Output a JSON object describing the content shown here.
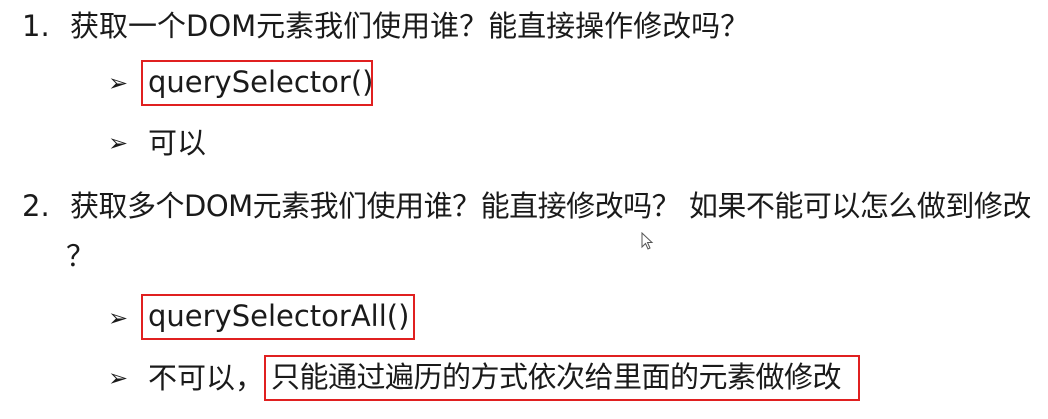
{
  "q1": {
    "number": "1.",
    "text": "获取一个DOM元素我们使用谁？能直接操作修改吗？",
    "answers": [
      {
        "bullet": "➢",
        "text": "querySelector()"
      },
      {
        "bullet": "➢",
        "text": "可以"
      }
    ]
  },
  "q2": {
    "number": "2.",
    "text_line1": "获取多个DOM元素我们使用谁？能直接修改吗？ 如果不能可以怎么做到修改",
    "text_line2": "？",
    "answers": [
      {
        "bullet": "➢",
        "text": "querySelectorAll()"
      },
      {
        "bullet": "➢",
        "prefix": "不可以，",
        "highlight": "只能通过遍历的方式依次给里面的元素做修改"
      }
    ]
  },
  "colors": {
    "highlight_border": "#e02020",
    "text": "#1a1a1a"
  },
  "icons": {
    "bullet": "arrow-bullet-icon",
    "cursor": "mouse-pointer-icon"
  }
}
